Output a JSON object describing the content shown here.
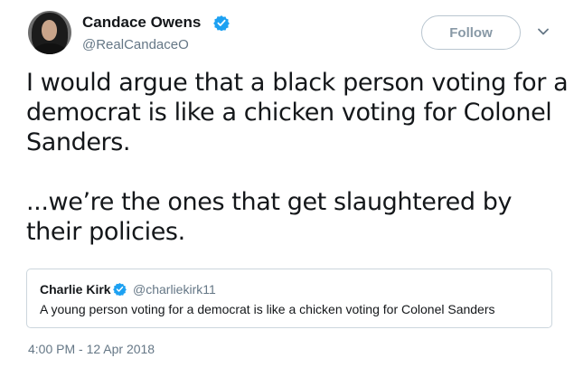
{
  "author": {
    "display_name": "Candace Owens",
    "handle": "@RealCandaceO",
    "verified": true
  },
  "follow_label": "Follow",
  "tweet": {
    "paragraphs": [
      "I would argue that a black person voting for a democrat is like a chicken voting for Colonel Sanders.",
      "...we’re the ones that get slaughtered by their policies."
    ]
  },
  "quoted_tweet": {
    "display_name": "Charlie Kirk",
    "handle": "@charliekirk11",
    "verified": true,
    "text": "A young person voting for a democrat is like a chicken voting for Colonel Sanders"
  },
  "timestamp": "4:00 PM - 12 Apr 2018",
  "colors": {
    "verified_blue": "#1da1f2",
    "secondary_text": "#657786",
    "border": "#ccd6dd"
  },
  "icons": {
    "verified": "verified-badge-icon",
    "caret": "chevron-down-icon"
  }
}
